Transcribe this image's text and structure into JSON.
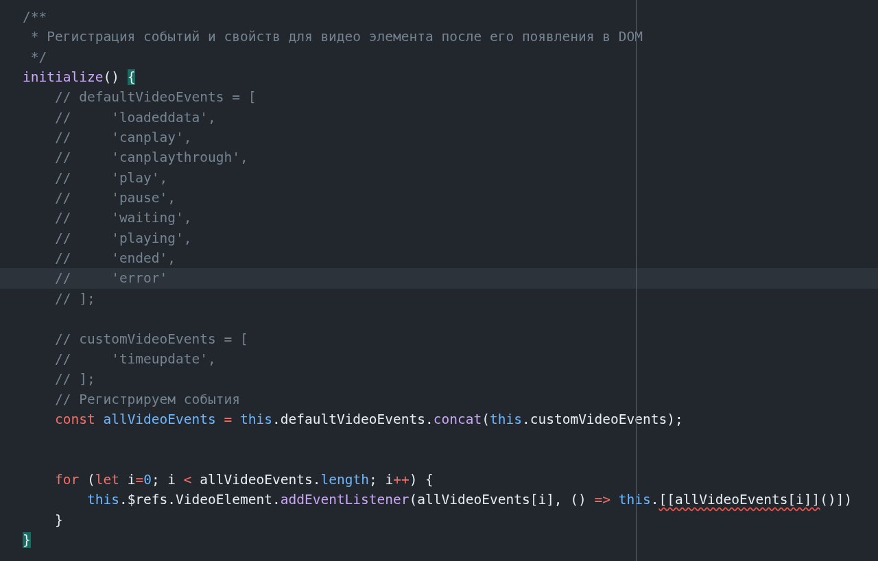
{
  "editor": {
    "lines": [
      {
        "highlighted": false,
        "tokens": [
          {
            "kind": "comment",
            "t": "/**"
          }
        ]
      },
      {
        "highlighted": false,
        "tokens": [
          {
            "kind": "comment",
            "t": " * Регистрация событий и свойств для видео элемента после его появления в DOM"
          }
        ]
      },
      {
        "highlighted": false,
        "tokens": [
          {
            "kind": "comment",
            "t": " */"
          }
        ]
      },
      {
        "highlighted": false,
        "tokens": [
          {
            "kind": "func",
            "t": "initialize"
          },
          {
            "kind": "plain",
            "t": "() "
          },
          {
            "kind": "match",
            "t": "{"
          }
        ]
      },
      {
        "highlighted": false,
        "tokens": [
          {
            "kind": "comment",
            "t": "    // defaultVideoEvents = ["
          }
        ]
      },
      {
        "highlighted": false,
        "tokens": [
          {
            "kind": "comment",
            "t": "    //     'loadeddata',"
          }
        ]
      },
      {
        "highlighted": false,
        "tokens": [
          {
            "kind": "comment",
            "t": "    //     'canplay',"
          }
        ]
      },
      {
        "highlighted": false,
        "tokens": [
          {
            "kind": "comment",
            "t": "    //     'canplaythrough',"
          }
        ]
      },
      {
        "highlighted": false,
        "tokens": [
          {
            "kind": "comment",
            "t": "    //     'play',"
          }
        ]
      },
      {
        "highlighted": false,
        "tokens": [
          {
            "kind": "comment",
            "t": "    //     'pause',"
          }
        ]
      },
      {
        "highlighted": false,
        "tokens": [
          {
            "kind": "comment",
            "t": "    //     'waiting',"
          }
        ]
      },
      {
        "highlighted": false,
        "tokens": [
          {
            "kind": "comment",
            "t": "    //     'playing',"
          }
        ]
      },
      {
        "highlighted": false,
        "tokens": [
          {
            "kind": "comment",
            "t": "    //     'ended',"
          }
        ]
      },
      {
        "highlighted": true,
        "tokens": [
          {
            "kind": "comment",
            "t": "    //     'error'"
          }
        ]
      },
      {
        "highlighted": false,
        "tokens": [
          {
            "kind": "comment",
            "t": "    // ];"
          }
        ]
      },
      {
        "highlighted": false
      },
      {
        "highlighted": false,
        "tokens": [
          {
            "kind": "comment",
            "t": "    // customVideoEvents = ["
          }
        ]
      },
      {
        "highlighted": false,
        "tokens": [
          {
            "kind": "comment",
            "t": "    //     'timeupdate',"
          }
        ]
      },
      {
        "highlighted": false,
        "tokens": [
          {
            "kind": "comment",
            "t": "    // ];"
          }
        ]
      },
      {
        "highlighted": false,
        "tokens": [
          {
            "kind": "comment",
            "t": "    // Регистрируем события"
          }
        ]
      },
      {
        "highlighted": false,
        "tokens": [
          {
            "kind": "keyword",
            "t": "    const "
          },
          {
            "kind": "var",
            "t": "allVideoEvents "
          },
          {
            "kind": "op",
            "t": "= "
          },
          {
            "kind": "var",
            "t": "this"
          },
          {
            "kind": "plain",
            "t": ".defaultVideoEvents."
          },
          {
            "kind": "func",
            "t": "concat"
          },
          {
            "kind": "plain",
            "t": "("
          },
          {
            "kind": "var",
            "t": "this"
          },
          {
            "kind": "plain",
            "t": ".customVideoEvents);"
          }
        ]
      },
      {
        "highlighted": false
      },
      {
        "highlighted": false
      },
      {
        "highlighted": false,
        "tokens": [
          {
            "kind": "keyword",
            "t": "    for"
          },
          {
            "kind": "plain",
            "t": " ("
          },
          {
            "kind": "keyword",
            "t": "let"
          },
          {
            "kind": "plain",
            "t": " i"
          },
          {
            "kind": "op",
            "t": "="
          },
          {
            "kind": "var",
            "t": "0"
          },
          {
            "kind": "plain",
            "t": "; i "
          },
          {
            "kind": "op",
            "t": "<"
          },
          {
            "kind": "plain",
            "t": " allVideoEvents."
          },
          {
            "kind": "var",
            "t": "length"
          },
          {
            "kind": "plain",
            "t": "; i"
          },
          {
            "kind": "op",
            "t": "++"
          },
          {
            "kind": "plain",
            "t": ") {"
          }
        ]
      },
      {
        "highlighted": false,
        "tokens": [
          {
            "kind": "var",
            "t": "        this"
          },
          {
            "kind": "plain",
            "t": ".$refs.VideoElement."
          },
          {
            "kind": "func",
            "t": "addEventListener"
          },
          {
            "kind": "plain",
            "t": "(allVideoEvents[i], () "
          },
          {
            "kind": "op",
            "t": "=> "
          },
          {
            "kind": "var",
            "t": "this"
          },
          {
            "kind": "plain",
            "t": "."
          },
          {
            "kind": "error",
            "t": "[[allVideoEvents[i]]"
          },
          {
            "kind": "plain",
            "t": "()])"
          }
        ]
      },
      {
        "highlighted": false,
        "tokens": [
          {
            "kind": "plain",
            "t": "    }"
          }
        ]
      },
      {
        "highlighted": false,
        "tokens": [
          {
            "kind": "match",
            "t": "}"
          }
        ]
      }
    ]
  }
}
